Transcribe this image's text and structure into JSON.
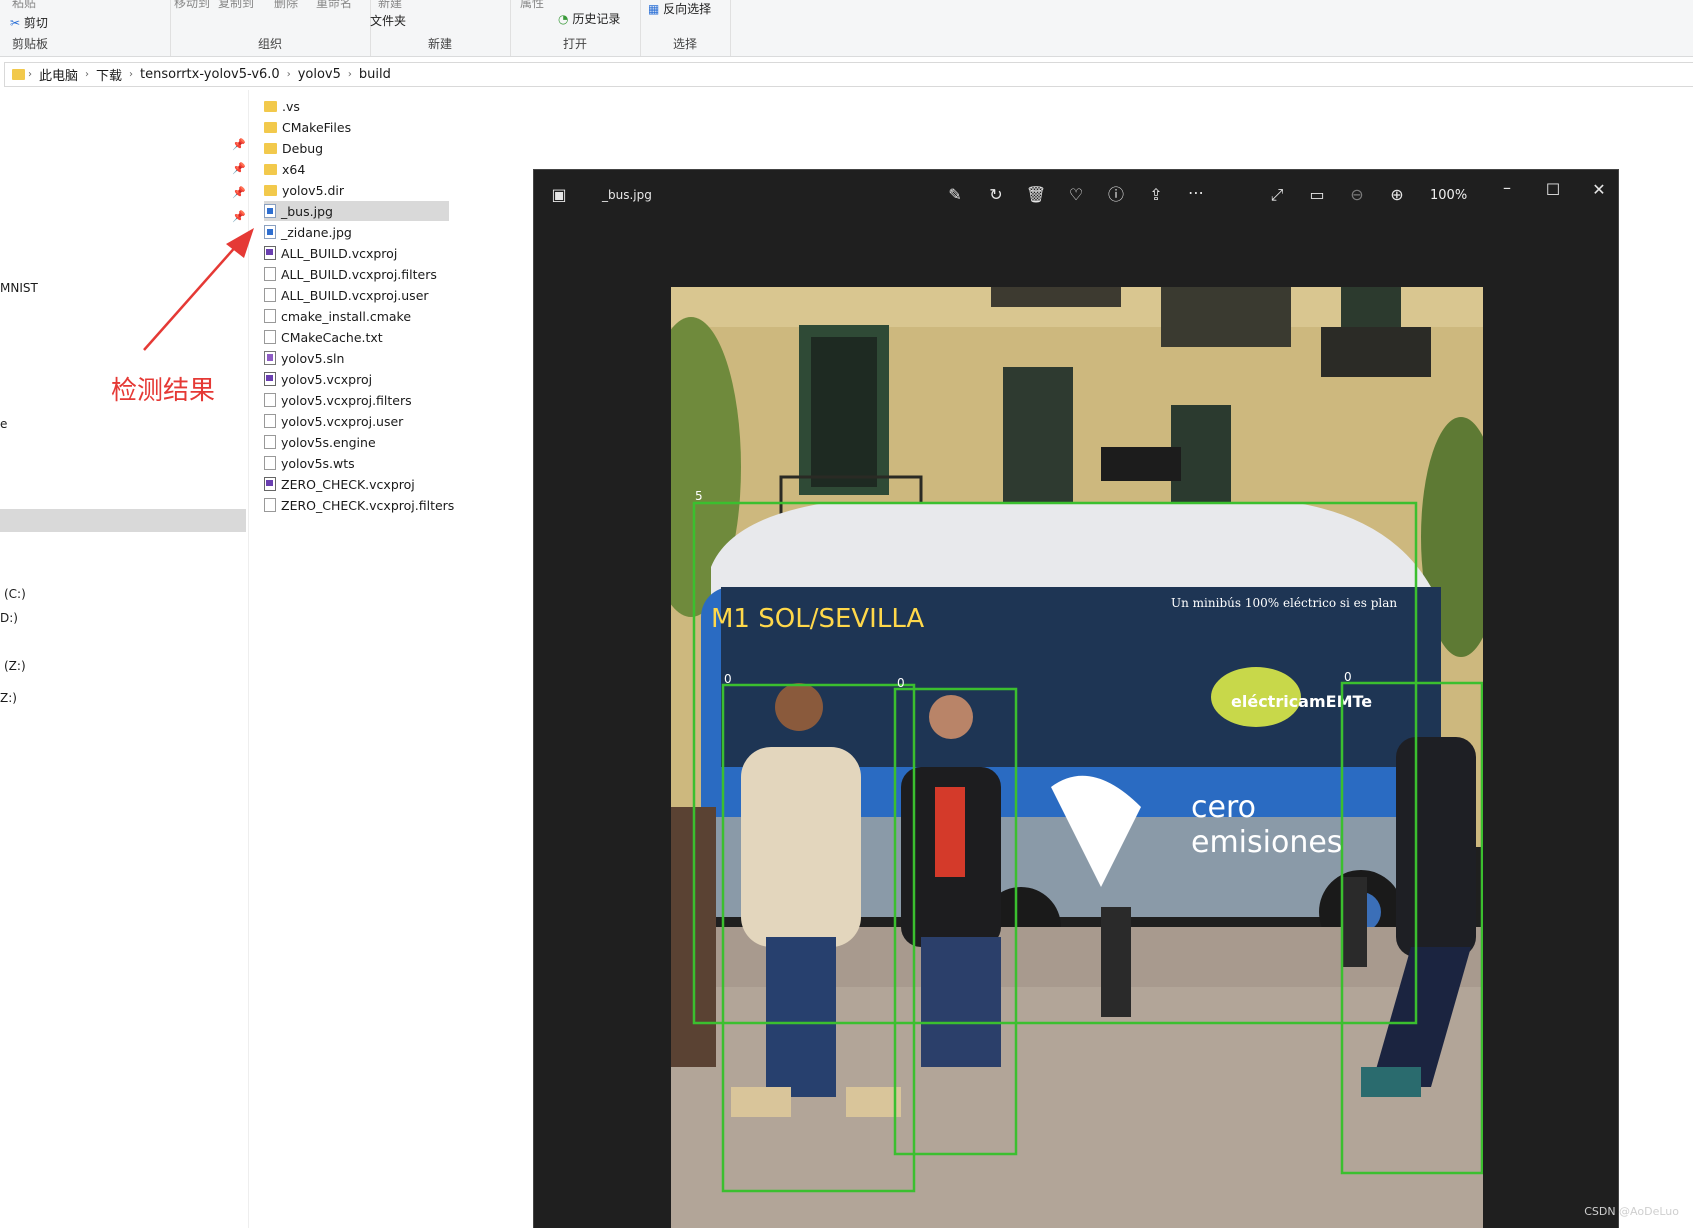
{
  "ribbon": {
    "top_texts": [
      "粘贴",
      "移动到",
      "复制到",
      "删除",
      "重命名",
      "新建",
      "属性"
    ],
    "cut_label": "剪切",
    "new_folder_label": "文件夹",
    "history_label": "历史记录",
    "invert_select_label": "反向选择",
    "groups": [
      "剪贴板",
      "组织",
      "新建",
      "打开",
      "选择"
    ]
  },
  "address": {
    "crumbs": [
      "此电脑",
      "下载",
      "tensorrtx-yolov5-v6.0",
      "yolov5",
      "build"
    ]
  },
  "nav": {
    "items": [
      "MNIST",
      "e",
      "(C:)",
      "D:)",
      "(Z:)",
      "Z:)"
    ]
  },
  "files": [
    {
      "name": ".vs",
      "type": "folder"
    },
    {
      "name": "CMakeFiles",
      "type": "folder"
    },
    {
      "name": "Debug",
      "type": "folder"
    },
    {
      "name": "x64",
      "type": "folder"
    },
    {
      "name": "yolov5.dir",
      "type": "folder"
    },
    {
      "name": "_bus.jpg",
      "type": "img",
      "selected": true
    },
    {
      "name": "_zidane.jpg",
      "type": "img"
    },
    {
      "name": "ALL_BUILD.vcxproj",
      "type": "proj"
    },
    {
      "name": "ALL_BUILD.vcxproj.filters",
      "type": "doc"
    },
    {
      "name": "ALL_BUILD.vcxproj.user",
      "type": "doc"
    },
    {
      "name": "cmake_install.cmake",
      "type": "doc"
    },
    {
      "name": "CMakeCache.txt",
      "type": "doc"
    },
    {
      "name": "yolov5.sln",
      "type": "sln"
    },
    {
      "name": "yolov5.vcxproj",
      "type": "proj"
    },
    {
      "name": "yolov5.vcxproj.filters",
      "type": "doc"
    },
    {
      "name": "yolov5.vcxproj.user",
      "type": "doc"
    },
    {
      "name": "yolov5s.engine",
      "type": "doc"
    },
    {
      "name": "yolov5s.wts",
      "type": "doc"
    },
    {
      "name": "ZERO_CHECK.vcxproj",
      "type": "proj"
    },
    {
      "name": "ZERO_CHECK.vcxproj.filters",
      "type": "doc"
    }
  ],
  "annotation": {
    "text": "检测结果",
    "color": "#e53935"
  },
  "viewer": {
    "title": "_bus.jpg",
    "zoom": "100%",
    "box_color": "#3bbf2f",
    "box_labels": [
      "5",
      "0",
      "0",
      "0"
    ]
  },
  "watermark": "CSDN @AoDeLuo"
}
